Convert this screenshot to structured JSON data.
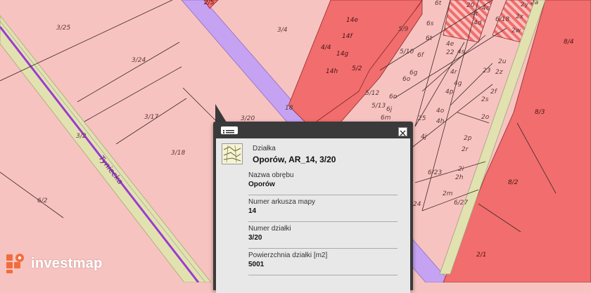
{
  "map": {
    "colors": {
      "parcel_bg": "#f7c3c0",
      "built_area": "#f26d6d",
      "road_purple": "#c6a2f3",
      "railway_band": "#e2e2b0",
      "purple_line": "#9b3bd1",
      "hatched": "#f26d6d"
    },
    "plot_labels": {
      "p3_25": "3/25",
      "p3_24": "3/24",
      "p3_4": "3/4",
      "p3_17": "3/17",
      "p3_18": "3/18",
      "p3_2": "3/2",
      "p6_2": "6/2",
      "p3_20": "3/20",
      "p18": "18",
      "p4_4": "4/4",
      "p5_2": "5/2",
      "p14e": "14e",
      "p14f": "14f",
      "p14g": "14g",
      "p14h": "14h",
      "p5_9": "5/9",
      "p5_10": "5/10",
      "p5_12": "5/12",
      "p5_13": "5/13",
      "p6s": "6s",
      "p6t": "6t",
      "p6f": "6f",
      "p6g": "6g",
      "p6o": "6o",
      "p6n": "6n",
      "p6j": "6j",
      "p6m": "6m",
      "p4e": "4e",
      "p4s": "4s",
      "p4c": "4c",
      "p4d": "4d",
      "p4r": "4r",
      "p4g": "4g",
      "p4p": "4p",
      "p4o": "4o",
      "p4h": "4h",
      "p4j": "4j",
      "p20": "20",
      "p4t": "4t",
      "p22": "22",
      "p23": "23",
      "p25": "25",
      "p2u": "2u",
      "p2z": "2z",
      "p2f": "2f",
      "p2s": "2s",
      "p2x": "2x",
      "p2y": "2y",
      "p2a": "2a",
      "p2w": "2w",
      "p2o": "2o",
      "p2p": "2p",
      "p2r": "2r",
      "p2i": "2i",
      "p2h": "2h",
      "p2m": "2m",
      "p2a2": "2a",
      "p6_23": "6/23",
      "p6_27": "6/27",
      "p6_18": "6/18",
      "p24": "24",
      "p8_4": "8/4",
      "p8_3": "8/3",
      "p8_2": "8/2",
      "p2_1": "2/1",
      "p2_5": "2/5",
      "p6t2": "6t"
    },
    "street_name": "Tyniecka"
  },
  "popup": {
    "title_small": "Działka",
    "title_main": "Oporów, AR_14, 3/20",
    "fields": [
      {
        "label": "Nazwa obrębu",
        "value": "Oporów"
      },
      {
        "label": "Numer arkusza mapy",
        "value": "14"
      },
      {
        "label": "Numer działki",
        "value": "3/20"
      },
      {
        "label": "Powierzchnia działki [m2]",
        "value": "5001"
      }
    ],
    "icons": {
      "list": "list-icon",
      "close": "close-icon",
      "parcel": "parcel-map-icon"
    }
  },
  "brand": {
    "name": "investmap",
    "logo_colors": [
      "#f26d3d",
      "#ffffff"
    ]
  }
}
